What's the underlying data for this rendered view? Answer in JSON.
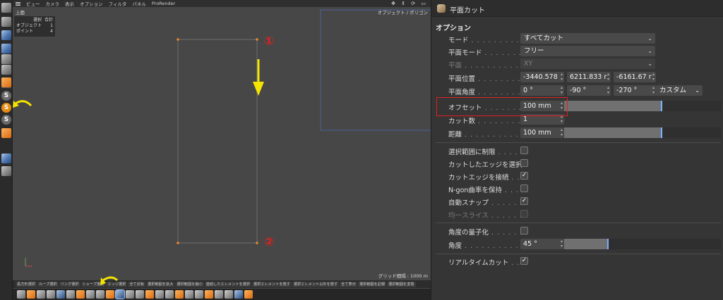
{
  "viewport": {
    "menu": [
      "ビュー",
      "カメラ",
      "表示",
      "オプション",
      "フィルタ",
      "パネル",
      "ProRender"
    ],
    "view_name": "上面",
    "camera_label": "オブジェクト / ポリゴン",
    "hud": {
      "header_a": "選択",
      "header_b": "合計",
      "rows": [
        {
          "label": "オブジェクト",
          "value": "1"
        },
        {
          "label": "ポイント",
          "value": "4"
        }
      ]
    },
    "grid_info": "グリッド間隔 : 1000 m",
    "annotations": {
      "start": "①",
      "end": "②"
    }
  },
  "command_bar": [
    "長方形選択",
    "ループ選択",
    "リング選択",
    "シェープ選択",
    "エッジ選択",
    "全て反転",
    "選択範囲を拡大",
    "選択範囲を縮小",
    "連結したエレメントを選択",
    "選択エレメントを隠す",
    "選択エレメント以外を隠す",
    "全て表示",
    "選択範囲を記録",
    "選択範囲を変換"
  ],
  "panel": {
    "title": "平面カット",
    "section": "オプション",
    "mode": {
      "label": "モード",
      "value": "すべてカット"
    },
    "plane_mode": {
      "label": "平面モード",
      "value": "フリー"
    },
    "plane": {
      "label": "平面",
      "value": "XY"
    },
    "plane_position": {
      "label": "平面位置",
      "x": "-3440.578",
      "y": "6211.833 r",
      "z": "-6161.67 r"
    },
    "plane_angle": {
      "label": "平面角度",
      "h": "0 °",
      "p": "-90 °",
      "b": "-270 °",
      "mode": "カスタム"
    },
    "offset": {
      "label": "オフセット",
      "value": "100 mm",
      "slider": 0.62
    },
    "cut_count": {
      "label": "カット数",
      "value": "1"
    },
    "distance": {
      "label": "距離",
      "value": "100 mm",
      "slider": 0.62
    },
    "checks": [
      {
        "label": "選択範囲に制限",
        "checked": false,
        "enabled": true
      },
      {
        "label": "カットしたエッジを選択",
        "checked": false,
        "enabled": true
      },
      {
        "label": "カットエッジを接続",
        "checked": true,
        "enabled": true
      },
      {
        "label": "N-gon曲率を保持",
        "checked": false,
        "enabled": true
      },
      {
        "label": "自動スナップ",
        "checked": true,
        "enabled": true
      },
      {
        "label": "均一スライス",
        "checked": false,
        "enabled": false
      }
    ],
    "quantize": {
      "label": "角度の量子化",
      "checked": false
    },
    "angle": {
      "label": "角度",
      "value": "45 °",
      "slider": 0.28
    },
    "realtime": {
      "label": "リアルタイムカット",
      "checked": true
    }
  },
  "colors": {
    "accent_yellow": "#f5e400",
    "highlight_red": "#e02020",
    "point_orange": "#e8872a",
    "annotation_red": "#e02020"
  }
}
